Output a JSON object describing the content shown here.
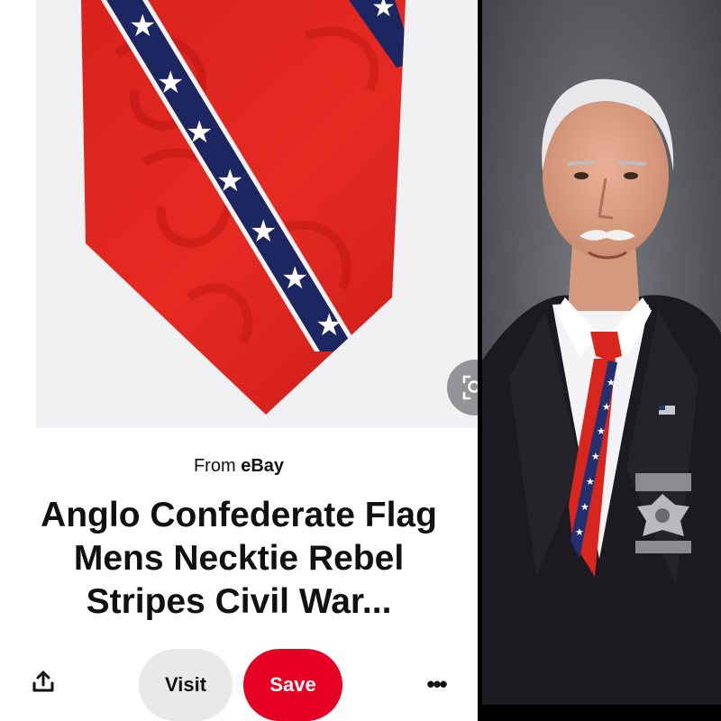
{
  "pin": {
    "image_alt": "Red necktie with blue diagonal stripe and white stars",
    "lens_icon": "visual-search-icon",
    "source_prefix": "From",
    "source_name": "eBay",
    "title": "Anglo Confederate Flag Mens Necktie Rebel Stripes Civil War...",
    "share_icon": "share-icon",
    "visit_label": "Visit",
    "save_label": "Save",
    "more_label": "•••",
    "colors": {
      "save": "#e60023",
      "visit": "#e9e9e9"
    }
  },
  "photo": {
    "alt": "Portrait of a white-haired man in a dark suit wearing a red tie with blue starred stripe and a badge"
  }
}
